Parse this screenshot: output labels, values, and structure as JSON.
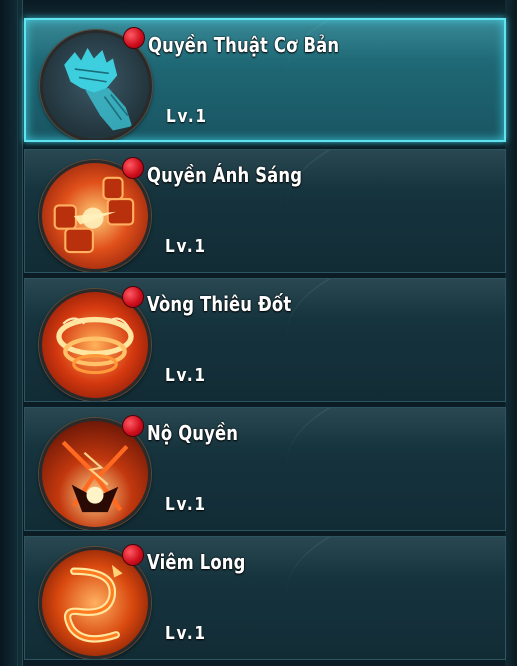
{
  "skills": [
    {
      "name": "Quyền Thuật Cơ Bản",
      "level": "Lv.1",
      "icon": "fist-icon",
      "selected": true
    },
    {
      "name": "Quyền Ánh Sáng",
      "level": "Lv.1",
      "icon": "light-fist-icon",
      "selected": false
    },
    {
      "name": "Vòng Thiêu Đốt",
      "level": "Lv.1",
      "icon": "fire-ring-icon",
      "selected": false
    },
    {
      "name": "Nộ Quyền",
      "level": "Lv.1",
      "icon": "rage-fist-icon",
      "selected": false
    },
    {
      "name": "Viêm Long",
      "level": "Lv.1",
      "icon": "flame-dragon-icon",
      "selected": false
    }
  ],
  "colors": {
    "selected_border": "#62e4f0",
    "notification_dot": "#d0101e",
    "panel": "#15323c"
  }
}
